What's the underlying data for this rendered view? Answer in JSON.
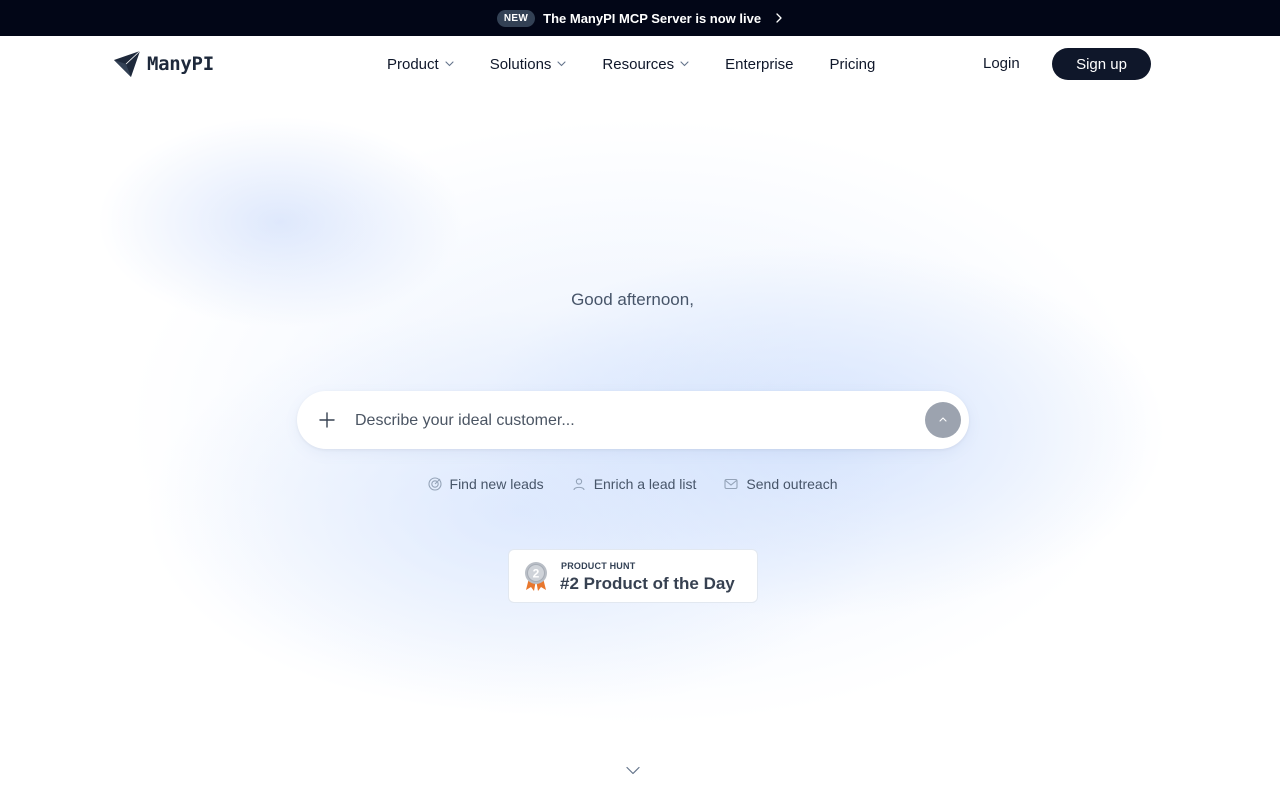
{
  "announcement": {
    "badge": "NEW",
    "message": "The ManyPI MCP Server is now live",
    "icon": "chevron-right-icon"
  },
  "header": {
    "logo_text": "ManyPI",
    "logo_icon": "paper-plane-logo-icon",
    "nav": [
      {
        "label": "Product",
        "has_dropdown": true
      },
      {
        "label": "Solutions",
        "has_dropdown": true
      },
      {
        "label": "Resources",
        "has_dropdown": true
      },
      {
        "label": "Enterprise",
        "has_dropdown": false
      },
      {
        "label": "Pricing",
        "has_dropdown": false
      }
    ],
    "login_label": "Login",
    "signup_label": "Sign up"
  },
  "hero": {
    "greeting": "Good afternoon,",
    "search": {
      "placeholder": "Describe your ideal customer...",
      "value": "",
      "add_icon": "plus-icon",
      "submit_icon": "arrow-up-icon"
    },
    "suggestions": [
      {
        "label": "Find new leads",
        "icon": "target-icon"
      },
      {
        "label": "Enrich a lead list",
        "icon": "user-icon"
      },
      {
        "label": "Send outreach",
        "icon": "mail-icon"
      }
    ],
    "product_hunt": {
      "eyebrow": "PRODUCT HUNT",
      "title": "#2 Product of the Day",
      "medal_number": "2"
    },
    "scroll_icon": "chevron-down-icon"
  },
  "colors": {
    "dark": "#020617",
    "button": "#0f172a",
    "muted_text": "#475569",
    "submit_bg": "#9ca3af",
    "medal_ribbon": "#e8772e"
  }
}
